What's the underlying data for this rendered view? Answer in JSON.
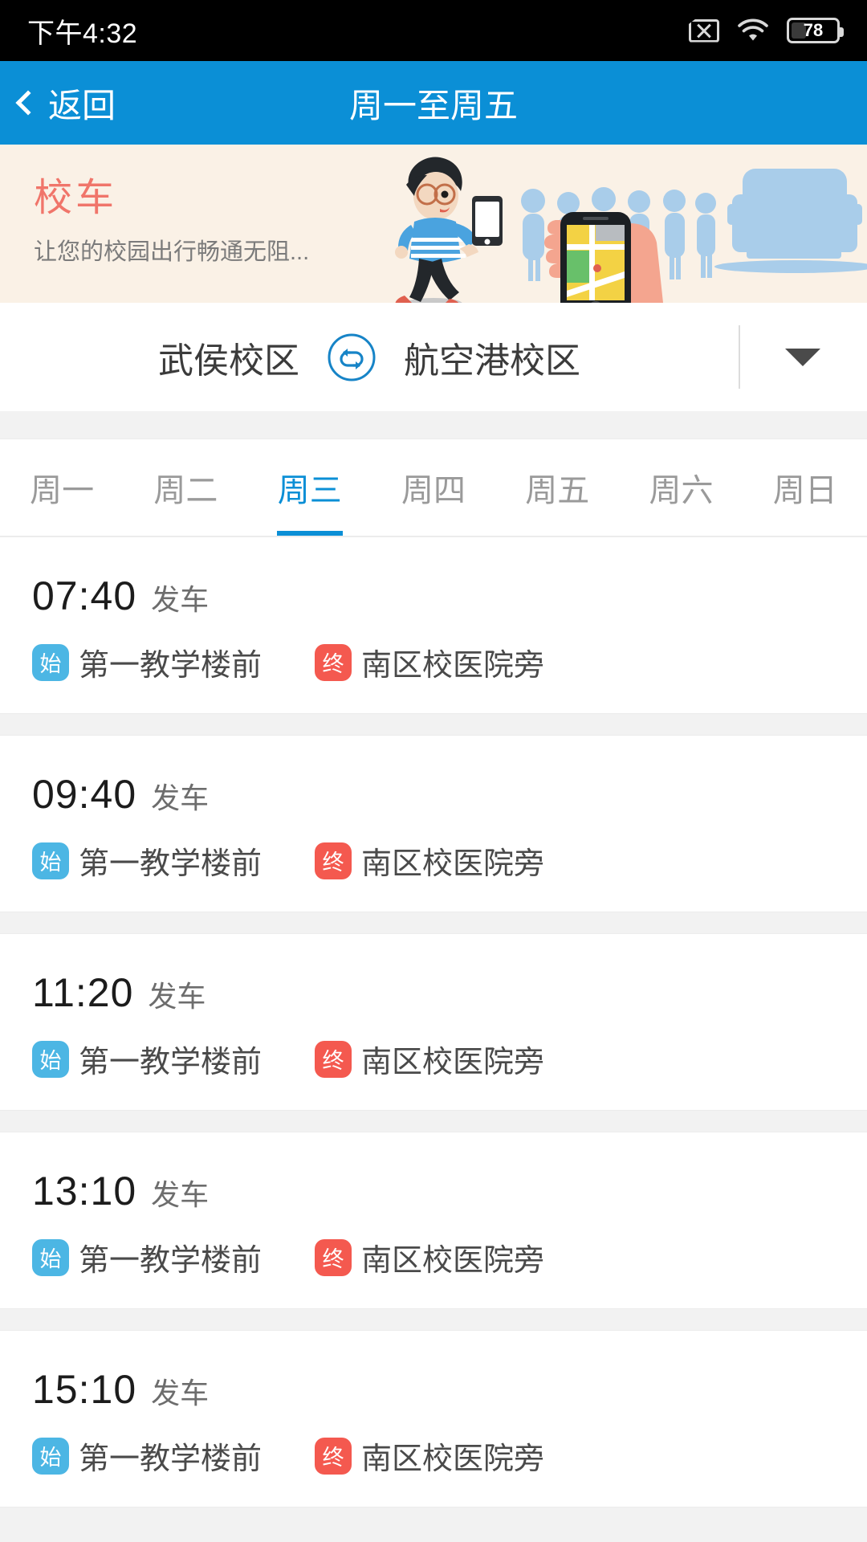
{
  "status_bar": {
    "time": "下午4:32",
    "sim_icon": "sim-no-signal-icon",
    "wifi_icon": "wifi-icon",
    "battery_icon": "battery-icon",
    "battery_percent": "78"
  },
  "navbar": {
    "back_label": "返回",
    "back_icon": "chevron-left-icon",
    "title": "周一至周五",
    "background_color": "#0b8fd6"
  },
  "banner": {
    "title": "校车",
    "title_color": "#f0756a",
    "subtitle": "让您的校园出行畅通无阻...",
    "background_color": "#faf1e6",
    "illustration": "student-with-phone-bus-illustration"
  },
  "route_selector": {
    "origin": "武侯校区",
    "destination": "航空港校区",
    "swap_icon": "swap-loop-icon",
    "dropdown_icon": "caret-down-icon",
    "accent_color": "#1784c7"
  },
  "weekday_tabs": {
    "active_index": 2,
    "accent_color": "#0b8fd6",
    "items": [
      {
        "label": "周一"
      },
      {
        "label": "周二"
      },
      {
        "label": "周三"
      },
      {
        "label": "周四"
      },
      {
        "label": "周五"
      },
      {
        "label": "周六"
      },
      {
        "label": "周日"
      }
    ]
  },
  "schedule": {
    "depart_label": "发车",
    "start_badge": "始",
    "end_badge": "终",
    "start_badge_color": "#4cb6e4",
    "end_badge_color": "#f4594f",
    "trips": [
      {
        "time": "07:40",
        "start": "第一教学楼前",
        "end": "南区校医院旁"
      },
      {
        "time": "09:40",
        "start": "第一教学楼前",
        "end": "南区校医院旁"
      },
      {
        "time": "11:20",
        "start": "第一教学楼前",
        "end": "南区校医院旁"
      },
      {
        "time": "13:10",
        "start": "第一教学楼前",
        "end": "南区校医院旁"
      },
      {
        "time": "15:10",
        "start": "第一教学楼前",
        "end": "南区校医院旁"
      }
    ]
  }
}
